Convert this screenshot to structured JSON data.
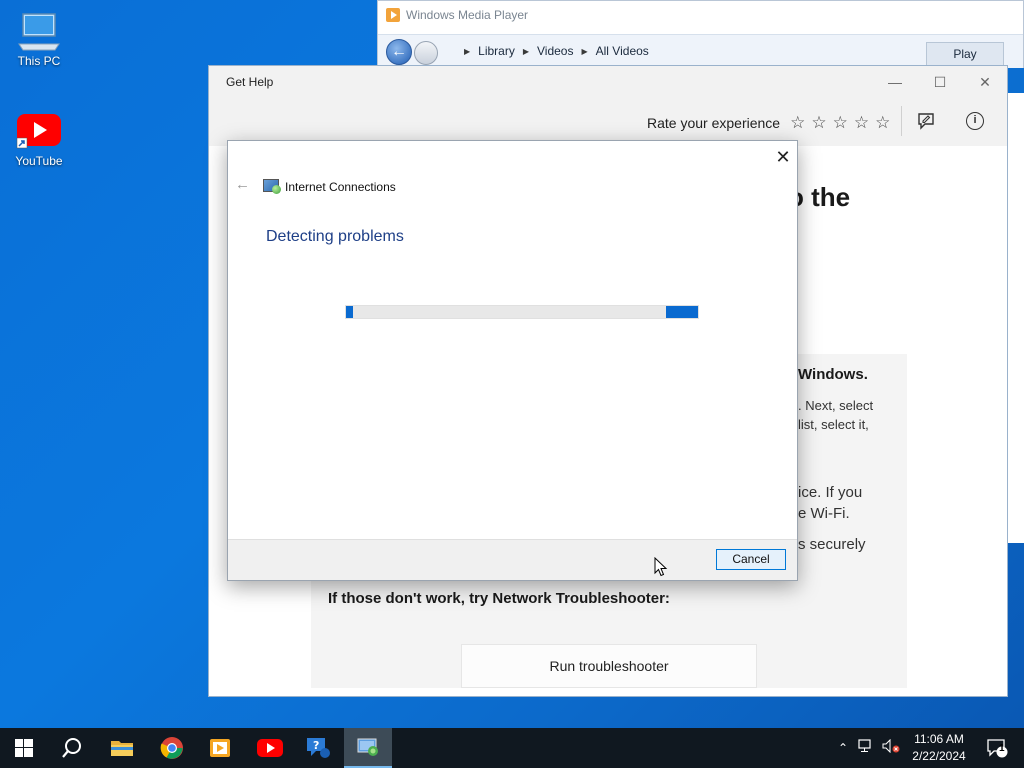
{
  "desktop": {
    "icons": [
      {
        "label": "This PC",
        "icon": "this-pc-icon"
      },
      {
        "label": "YouTube",
        "icon": "youtube-icon"
      }
    ]
  },
  "wmp": {
    "title": "Windows Media Player",
    "breadcrumbs": [
      "Library",
      "Videos",
      "All Videos"
    ],
    "play_label": "Play"
  },
  "gethelp": {
    "title": "Get Help",
    "rate_label": "Rate your experience",
    "heading_fragment": "o the",
    "step_title_fragment": "Windows.",
    "step_text_line1": ". Next, select",
    "step_text_line2": "list, select it,",
    "para_line1": "ice. If you",
    "para_line2": "e Wi-Fi.",
    "para2_fragment": "s securely",
    "troubleshooter_prompt": "If those don't work, try Network Troubleshooter:",
    "run_button": "Run troubleshooter"
  },
  "dialog": {
    "title": "Internet Connections",
    "status": "Detecting problems",
    "cancel_label": "Cancel",
    "accent_color": "#0a6ad0"
  },
  "taskbar": {
    "apps": [
      "start-icon",
      "search-icon",
      "file-explorer-icon",
      "chrome-icon",
      "media-player-icon",
      "youtube-icon",
      "get-help-icon",
      "internet-connections-icon"
    ],
    "time": "11:06 AM",
    "date": "2/22/2024",
    "notification_count": "1"
  }
}
